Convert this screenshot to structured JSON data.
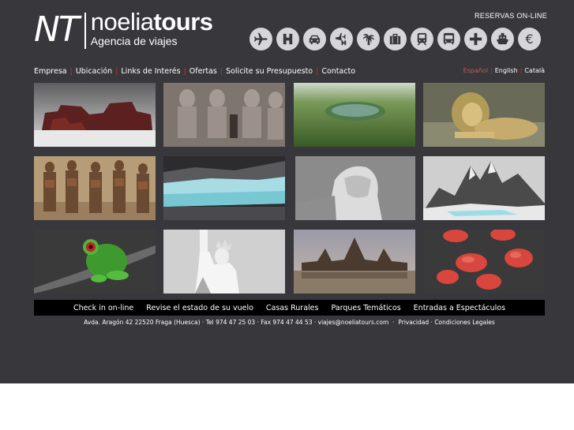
{
  "header": {
    "logo_monogram": "NT",
    "logo_brand_light": "noelia",
    "logo_brand_bold": "tours",
    "logo_tagline": "Agencia de viajes",
    "reservas_label": "RESERVAS ON-LINE",
    "booking_icons": [
      "plane-icon",
      "hotel-icon",
      "car-icon",
      "plane-hotel-icon",
      "palm-tree-icon",
      "suitcase-icon",
      "train-icon",
      "bus-icon",
      "medical-cross-icon",
      "ship-icon",
      "euro-icon"
    ]
  },
  "nav": {
    "items": [
      "Empresa",
      "Ubicación",
      "Links de Interés",
      "Ofertas",
      "Solicite su Presupuesto",
      "Contacto"
    ]
  },
  "languages": {
    "items": [
      "Español",
      "English",
      "Català"
    ],
    "active": "Español"
  },
  "gallery": {
    "tiles": [
      "red-rock-formation",
      "abu-simbel-statues",
      "green-crater-lake",
      "lion-resting",
      "tribal-people",
      "perito-moreno-glacier",
      "christ-redeemer-statue",
      "patagonia-mountains",
      "green-tree-frog",
      "statue-of-liberty",
      "angkor-wat-temple",
      "red-chinese-lanterns"
    ]
  },
  "bottom_bar": {
    "links": [
      "Check in on-line",
      "Revise el estado de su vuelo",
      "Casas Rurales",
      "Parques Temáticos",
      "Entradas a Espectáculos"
    ]
  },
  "footer": {
    "address": "Avda. Aragón 42 22520 Fraga (Huesca) · Tel 974 47 25 03 · Fax 974 47 44 53 · viajes@noeliatours.com",
    "separator": "·",
    "privacy": "Privacidad",
    "legal": "Condiciones Legales"
  },
  "colors": {
    "background": "#38373c",
    "separator": "#c8302e",
    "active_language": "#c25a55",
    "icon_circle": "#d6d6d8",
    "bottom_bar": "#000000"
  }
}
